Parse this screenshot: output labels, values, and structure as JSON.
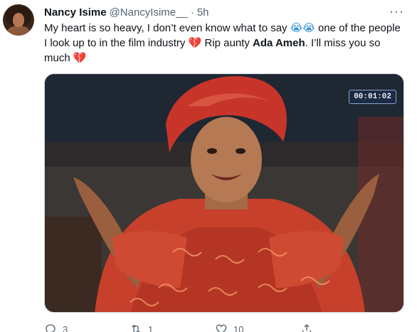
{
  "author": {
    "name": "Nancy Isime",
    "handle": "@NancyIsime__",
    "separator": "·",
    "time": "5h"
  },
  "tweet": {
    "text_1": "My heart is so heavy, I don’t even know what to say ",
    "emoji_cry": "😭😭",
    "text_2": " one of the people I look up to in the film industry ",
    "emoji_broken_heart_1": "💔",
    "text_3": " Rip aunty ",
    "bold_name": "Ada Ameh",
    "text_4": ". I’ll miss you so much ",
    "emoji_broken_heart_2": "💔"
  },
  "media": {
    "timecode": "00:01:02"
  },
  "actions": {
    "replies": "3",
    "retweets": "1",
    "likes": "10"
  },
  "icons": {
    "more": "more-icon",
    "reply": "reply-icon",
    "retweet": "retweet-icon",
    "like": "heart-icon",
    "share": "share-icon"
  },
  "colors": {
    "text": "#0f1419",
    "secondary": "#536471",
    "border": "#cfd9de"
  }
}
